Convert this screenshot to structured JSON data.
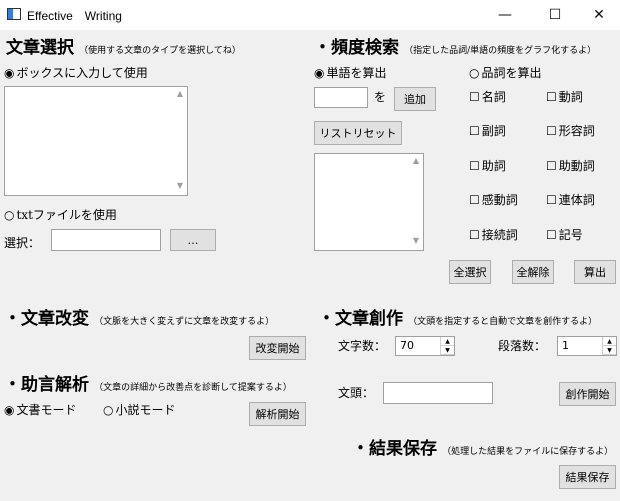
{
  "window": {
    "title": "Effective　Writing",
    "minimize": "—",
    "maximize": "☐",
    "close": "✕"
  },
  "select_section": {
    "heading": "文章選択",
    "note": "（使用する文章のタイプを選択してね）",
    "radio_box": "ボックスに入力して使用",
    "radio_txt": "txtファイルを使用",
    "select_label": "選択：",
    "browse_button": "…",
    "path_value": ""
  },
  "freq_section": {
    "heading": "・頻度検索",
    "note": "（指定した品詞/単語の頻度をグラフ化するよ）",
    "radio_word": "単語を算出",
    "radio_pos": "品詞を算出",
    "word_input": "",
    "wo": "を",
    "add_button": "追加",
    "reset_button": "リストリセット",
    "pos": [
      "名詞",
      "動詞",
      "副詞",
      "形容詞",
      "助詞",
      "助動詞",
      "感動詞",
      "連体詞",
      "接続詞",
      "記号"
    ],
    "select_all": "全選択",
    "deselect_all": "全解除",
    "calculate": "算出"
  },
  "modify_section": {
    "heading": "・文章改変",
    "note": "（文脈を大きく変えずに文章を改変するよ）",
    "start_button": "改変開始"
  },
  "advice_section": {
    "heading": "・助言解析",
    "note": "（文章の詳細から改善点を診断して提案するよ）",
    "radio_doc": "文書モード",
    "radio_novel": "小説モード",
    "start_button": "解析開始"
  },
  "create_section": {
    "heading": "・文章創作",
    "note": "（文頭を指定すると自動で文章を創作するよ）",
    "char_label": "文字数：",
    "char_value": "70",
    "para_label": "段落数：",
    "para_value": "1",
    "head_label": "文頭：",
    "head_value": "",
    "start_button": "創作開始"
  },
  "save_section": {
    "heading": "・結果保存",
    "note": "（処理した結果をファイルに保存するよ）",
    "save_button": "結果保存"
  },
  "glyphs": {
    "radio_on": "◉",
    "radio_off": "○",
    "check_off": "☐",
    "spin_up": "▲",
    "spin_down": "▼",
    "scroll_up": "▲",
    "scroll_down": "▼"
  }
}
